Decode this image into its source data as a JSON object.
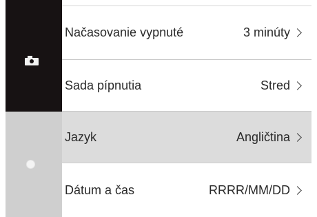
{
  "sidebar": {
    "tabs": [
      {
        "icon": "camera-icon"
      },
      {
        "icon": "gear-icon"
      }
    ]
  },
  "menu": {
    "items": [
      {
        "label": "Načasovanie vypnuté",
        "value": "3 minúty"
      },
      {
        "label": "Sada pípnutia",
        "value": "Stred"
      },
      {
        "label": "Jazyk",
        "value": "Angličtina",
        "selected": true
      },
      {
        "label": "Dátum a čas",
        "value": "RRRR/MM/DD"
      }
    ]
  },
  "colors": {
    "sidebar_active": "#171213",
    "sidebar_inactive": "#cfcfcf",
    "row_selected": "#dcdcdc"
  }
}
